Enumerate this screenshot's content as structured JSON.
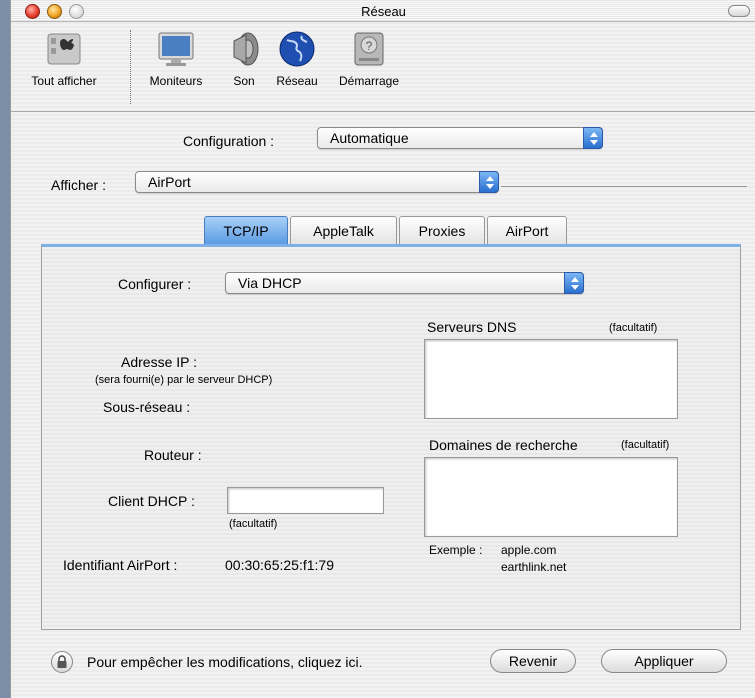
{
  "window": {
    "title": "Réseau"
  },
  "toolbar": {
    "items": [
      {
        "label": "Tout afficher",
        "icon": "apple-show-all-icon"
      },
      {
        "label": "Moniteurs",
        "icon": "monitor-icon"
      },
      {
        "label": "Son",
        "icon": "speaker-icon"
      },
      {
        "label": "Réseau",
        "icon": "globe-icon"
      },
      {
        "label": "Démarrage",
        "icon": "hard-disk-icon"
      }
    ]
  },
  "configuration": {
    "label": "Configuration :",
    "value": "Automatique"
  },
  "afficher": {
    "label": "Afficher :",
    "value": "AirPort"
  },
  "tabs": [
    {
      "label": "TCP/IP",
      "active": true
    },
    {
      "label": "AppleTalk",
      "active": false
    },
    {
      "label": "Proxies",
      "active": false
    },
    {
      "label": "AirPort",
      "active": false
    }
  ],
  "tcpip": {
    "configurer_label": "Configurer :",
    "configurer_value": "Via DHCP",
    "ip_label": "Adresse IP :",
    "ip_note": "(sera fourni(e) par le serveur DHCP)",
    "subnet_label": "Sous-réseau :",
    "router_label": "Routeur :",
    "dhcp_client_label": "Client DHCP :",
    "dhcp_client_value": "",
    "dhcp_client_note": "(facultatif)",
    "airport_id_label": "Identifiant AirPort :",
    "airport_id_value": "00:30:65:25:f1:79",
    "dns_label": "Serveurs DNS",
    "dns_note": "(facultatif)",
    "search_domains_label": "Domaines de recherche",
    "search_domains_note": "(facultatif)",
    "example_label": "Exemple :",
    "example_1": "apple.com",
    "example_2": "earthlink.net"
  },
  "footer": {
    "lock_text": "Pour empêcher les modifications, cliquez ici.",
    "revert_label": "Revenir",
    "apply_label": "Appliquer"
  },
  "colors": {
    "accent": "#2a6fd0",
    "tab_active": "#5b9ce3"
  }
}
